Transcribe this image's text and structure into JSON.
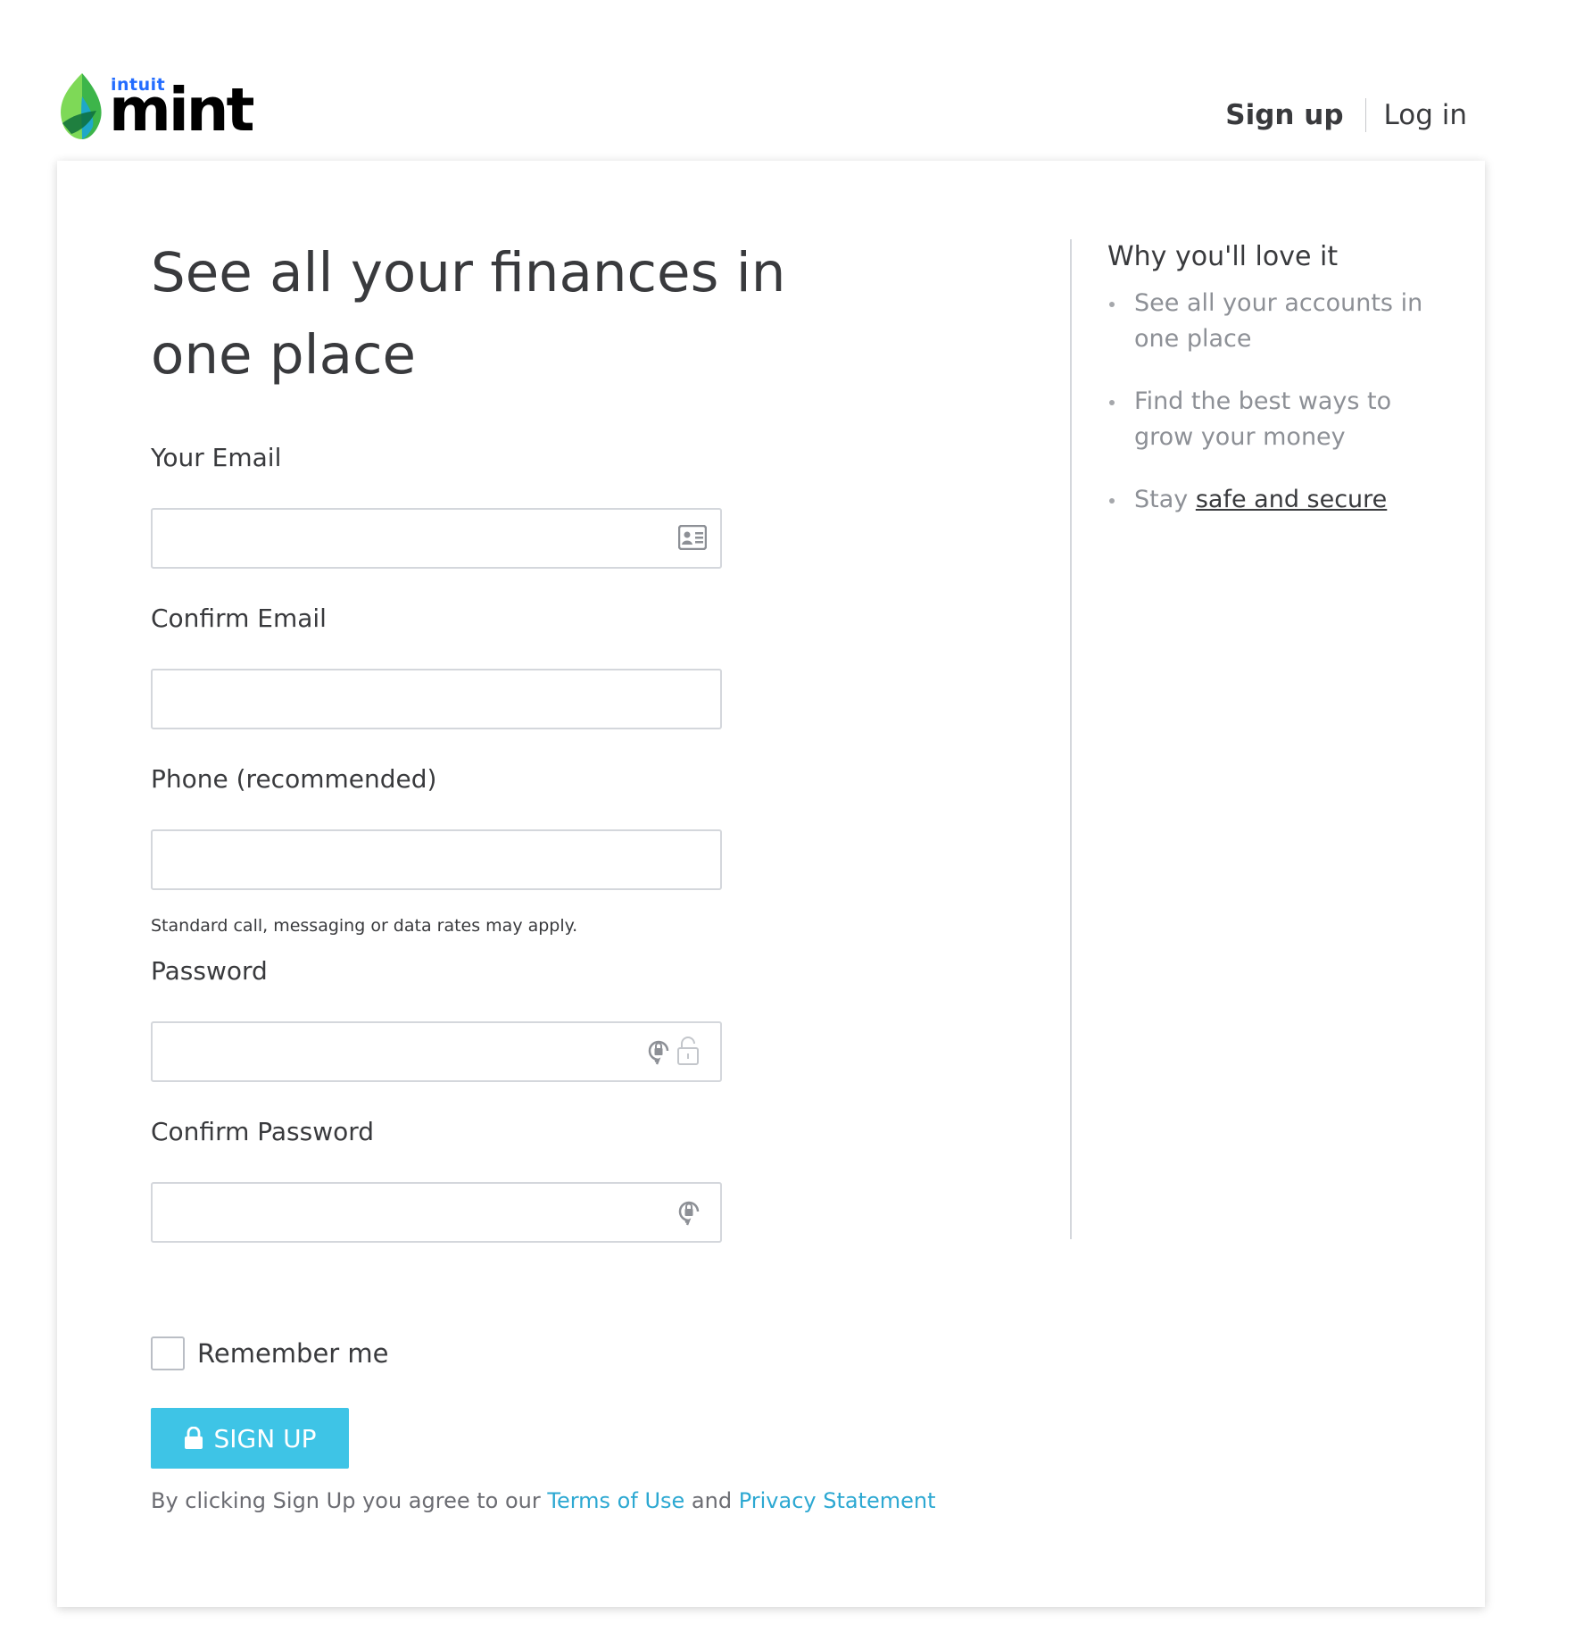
{
  "brand": {
    "company": "intuit",
    "product": "mint"
  },
  "nav": {
    "signup_label": "Sign up",
    "login_label": "Log in"
  },
  "form": {
    "headline": "See all your finances in one place",
    "email": {
      "label": "Your Email",
      "value": ""
    },
    "confirm_email": {
      "label": "Confirm Email",
      "value": ""
    },
    "phone": {
      "label": "Phone (recommended)",
      "value": "",
      "helper": "Standard call, messaging or data rates may apply."
    },
    "password": {
      "label": "Password",
      "value": ""
    },
    "confirm_password": {
      "label": "Confirm Password",
      "value": ""
    },
    "remember_me": {
      "label": "Remember me",
      "checked": false
    },
    "submit_label": "SIGN UP",
    "legal": {
      "prefix": "By clicking Sign Up you agree to our",
      "terms": "Terms of Use",
      "and": "and",
      "privacy": "Privacy Statement"
    }
  },
  "sidebar": {
    "title": "Why you'll love it",
    "items": [
      {
        "text": "See all your accounts in one place"
      },
      {
        "text": "Find the best ways to grow your money"
      },
      {
        "text_prefix": "Stay",
        "link": "safe and secure"
      }
    ]
  },
  "icons": {
    "email_autofill": "contact-card-icon",
    "password_generate": "key-refresh-icon",
    "password_lock": "padlock-icon",
    "confirm_password_generate": "key-refresh-icon",
    "submit": "padlock-icon"
  },
  "colors": {
    "button": "#3ec4e6",
    "link": "#2ca8d2",
    "text": "#393a3d",
    "muted_text": "#8d9096",
    "input_border": "#d4d7dc",
    "brand_blue": "#236cff",
    "leaf_green": "#7ed957"
  }
}
